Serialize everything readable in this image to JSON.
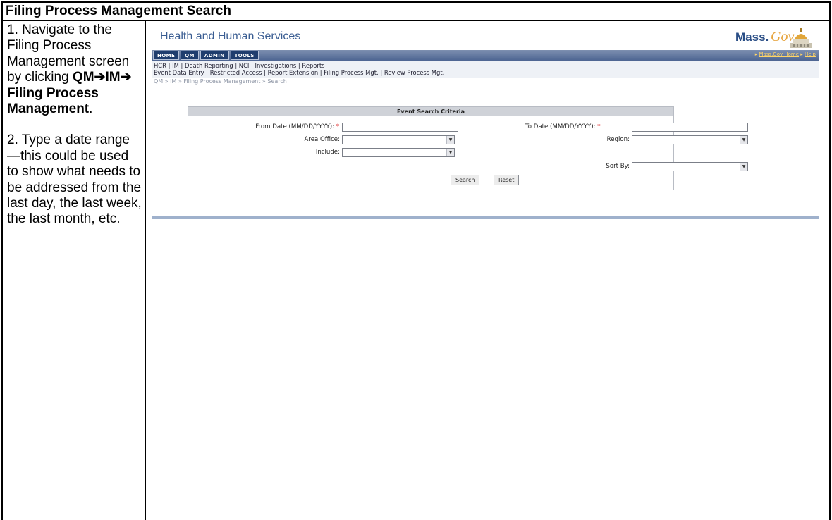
{
  "doc": {
    "title": "Filing Process Management Search",
    "step1_text": "1. Navigate to the Filing Process Management screen by clicking ",
    "step1_path": "QM➔IM➔ Filing Process Management",
    "step1_end": ".",
    "step2_text": "2. Type a date range—this could be used to show what needs to be addressed from the last day, the last week, the last month, etc."
  },
  "screenshot": {
    "app_title": "Health and Human Services",
    "logo_mass": "Mass.",
    "logo_gov": "Gov",
    "nav_tabs": [
      "HOME",
      "QM",
      "ADMIN",
      "TOOLS"
    ],
    "nav_links": [
      "Mass.Gov Home",
      "Help"
    ],
    "sublinks_row1": "HCR | IM | Death Reporting | NCI | Investigations | Reports",
    "sublinks_row2": "Event Data Entry | Restricted Access | Report Extension | Filing Process Mgt. | Review Process Mgt.",
    "breadcrumb": "QM » IM » Filing Process Management » Search",
    "form": {
      "header": "Event Search Criteria",
      "from_date_label": "From Date (MM/DD/YYYY):",
      "to_date_label": "To Date (MM/DD/YYYY):",
      "required_mark": "*",
      "area_office_label": "Area Office:",
      "region_label": "Region:",
      "include_label": "Include:",
      "sort_by_label": "Sort By:",
      "search_button": "Search",
      "reset_button": "Reset"
    }
  }
}
